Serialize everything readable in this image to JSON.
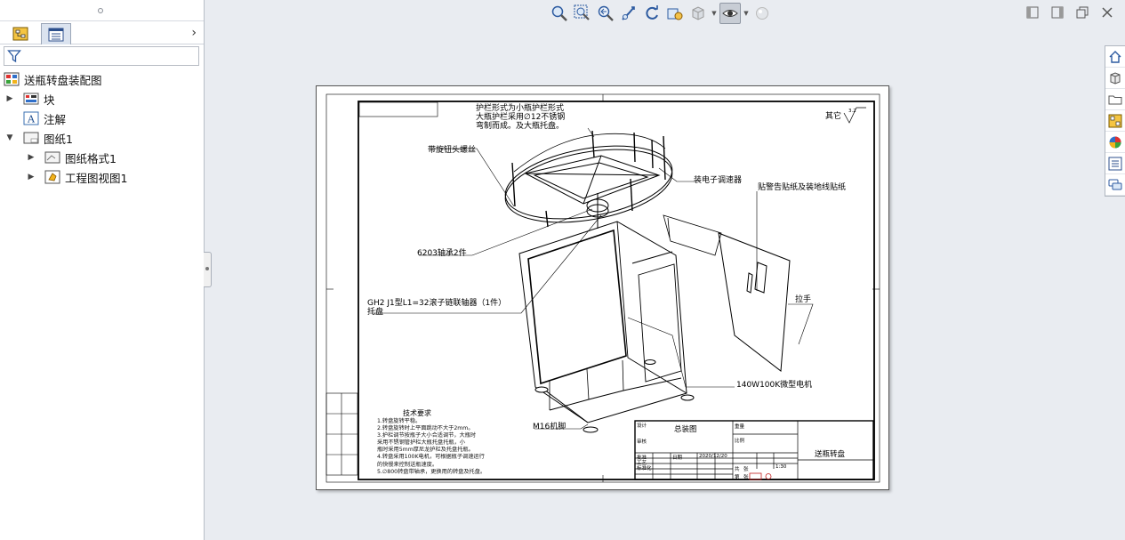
{
  "tree": {
    "root_label": "送瓶转盘装配图",
    "items": [
      {
        "label": "块",
        "level": 1,
        "expander": "▶"
      },
      {
        "label": "注解",
        "level": 1,
        "expander": ""
      },
      {
        "label": "图纸1",
        "level": 1,
        "expander": "▼"
      },
      {
        "label": "图纸格式1",
        "level": 2,
        "expander": "▶"
      },
      {
        "label": "工程图视图1",
        "level": 2,
        "expander": "▶"
      }
    ]
  },
  "panel": {
    "more_glyph": "›"
  },
  "drawing": {
    "annotations": {
      "guard_line1": "护栏形式为小瓶护栏形式",
      "guard_line2": "大瓶护栏采用∅12不锈钢",
      "guard_line3": "弯制而成。及大瓶托盘。",
      "other_finish": "其它",
      "finish_value": "3.2",
      "screw": "带旋钮头螺丝",
      "reducer": "装电子调速器",
      "sticker": "贴警告贴纸及装地线贴纸",
      "bearing": "6203轴承2件",
      "chain": "GH2 J1型L1=32滚子链联轴器（1件）",
      "tray": "托盘",
      "handle": "拉手",
      "motor": "140W100K微型电机",
      "foot": "M16机脚"
    },
    "tech_title": "技术要求",
    "tech_lines": [
      "1.转盘旋转平稳。",
      "2.转盘旋转时上平面跳动不大于2mm。",
      "3.护栏调节按瓶子大小合适调节，大瓶时",
      "采用不锈钢管护栏大瓶托盘托瓶，小",
      "瓶时采用5mm厚尼龙护栏及托盘托瓶。",
      "4.转盘采用100K电机，可根据瓶子调速运行",
      "的快慢来控制送瓶速度。",
      "5.∅800转盘带轴承，更换用的转盘及托盘。"
    ],
    "title_block": {
      "main_title": "总装图",
      "drawing_name": "送瓶转盘",
      "scale": "1:30",
      "date": "2020/12/20",
      "small_cells": [
        "设计",
        "审核",
        "批准",
        "工艺",
        "标准化",
        "日期",
        "重量",
        "比例",
        "共",
        "张",
        "第",
        "张"
      ]
    }
  },
  "colors": {
    "canvas_bg": "#e9ecf1",
    "sheet_bg": "#ffffff",
    "line": "#000000",
    "accent_red": "#c21d1d"
  }
}
